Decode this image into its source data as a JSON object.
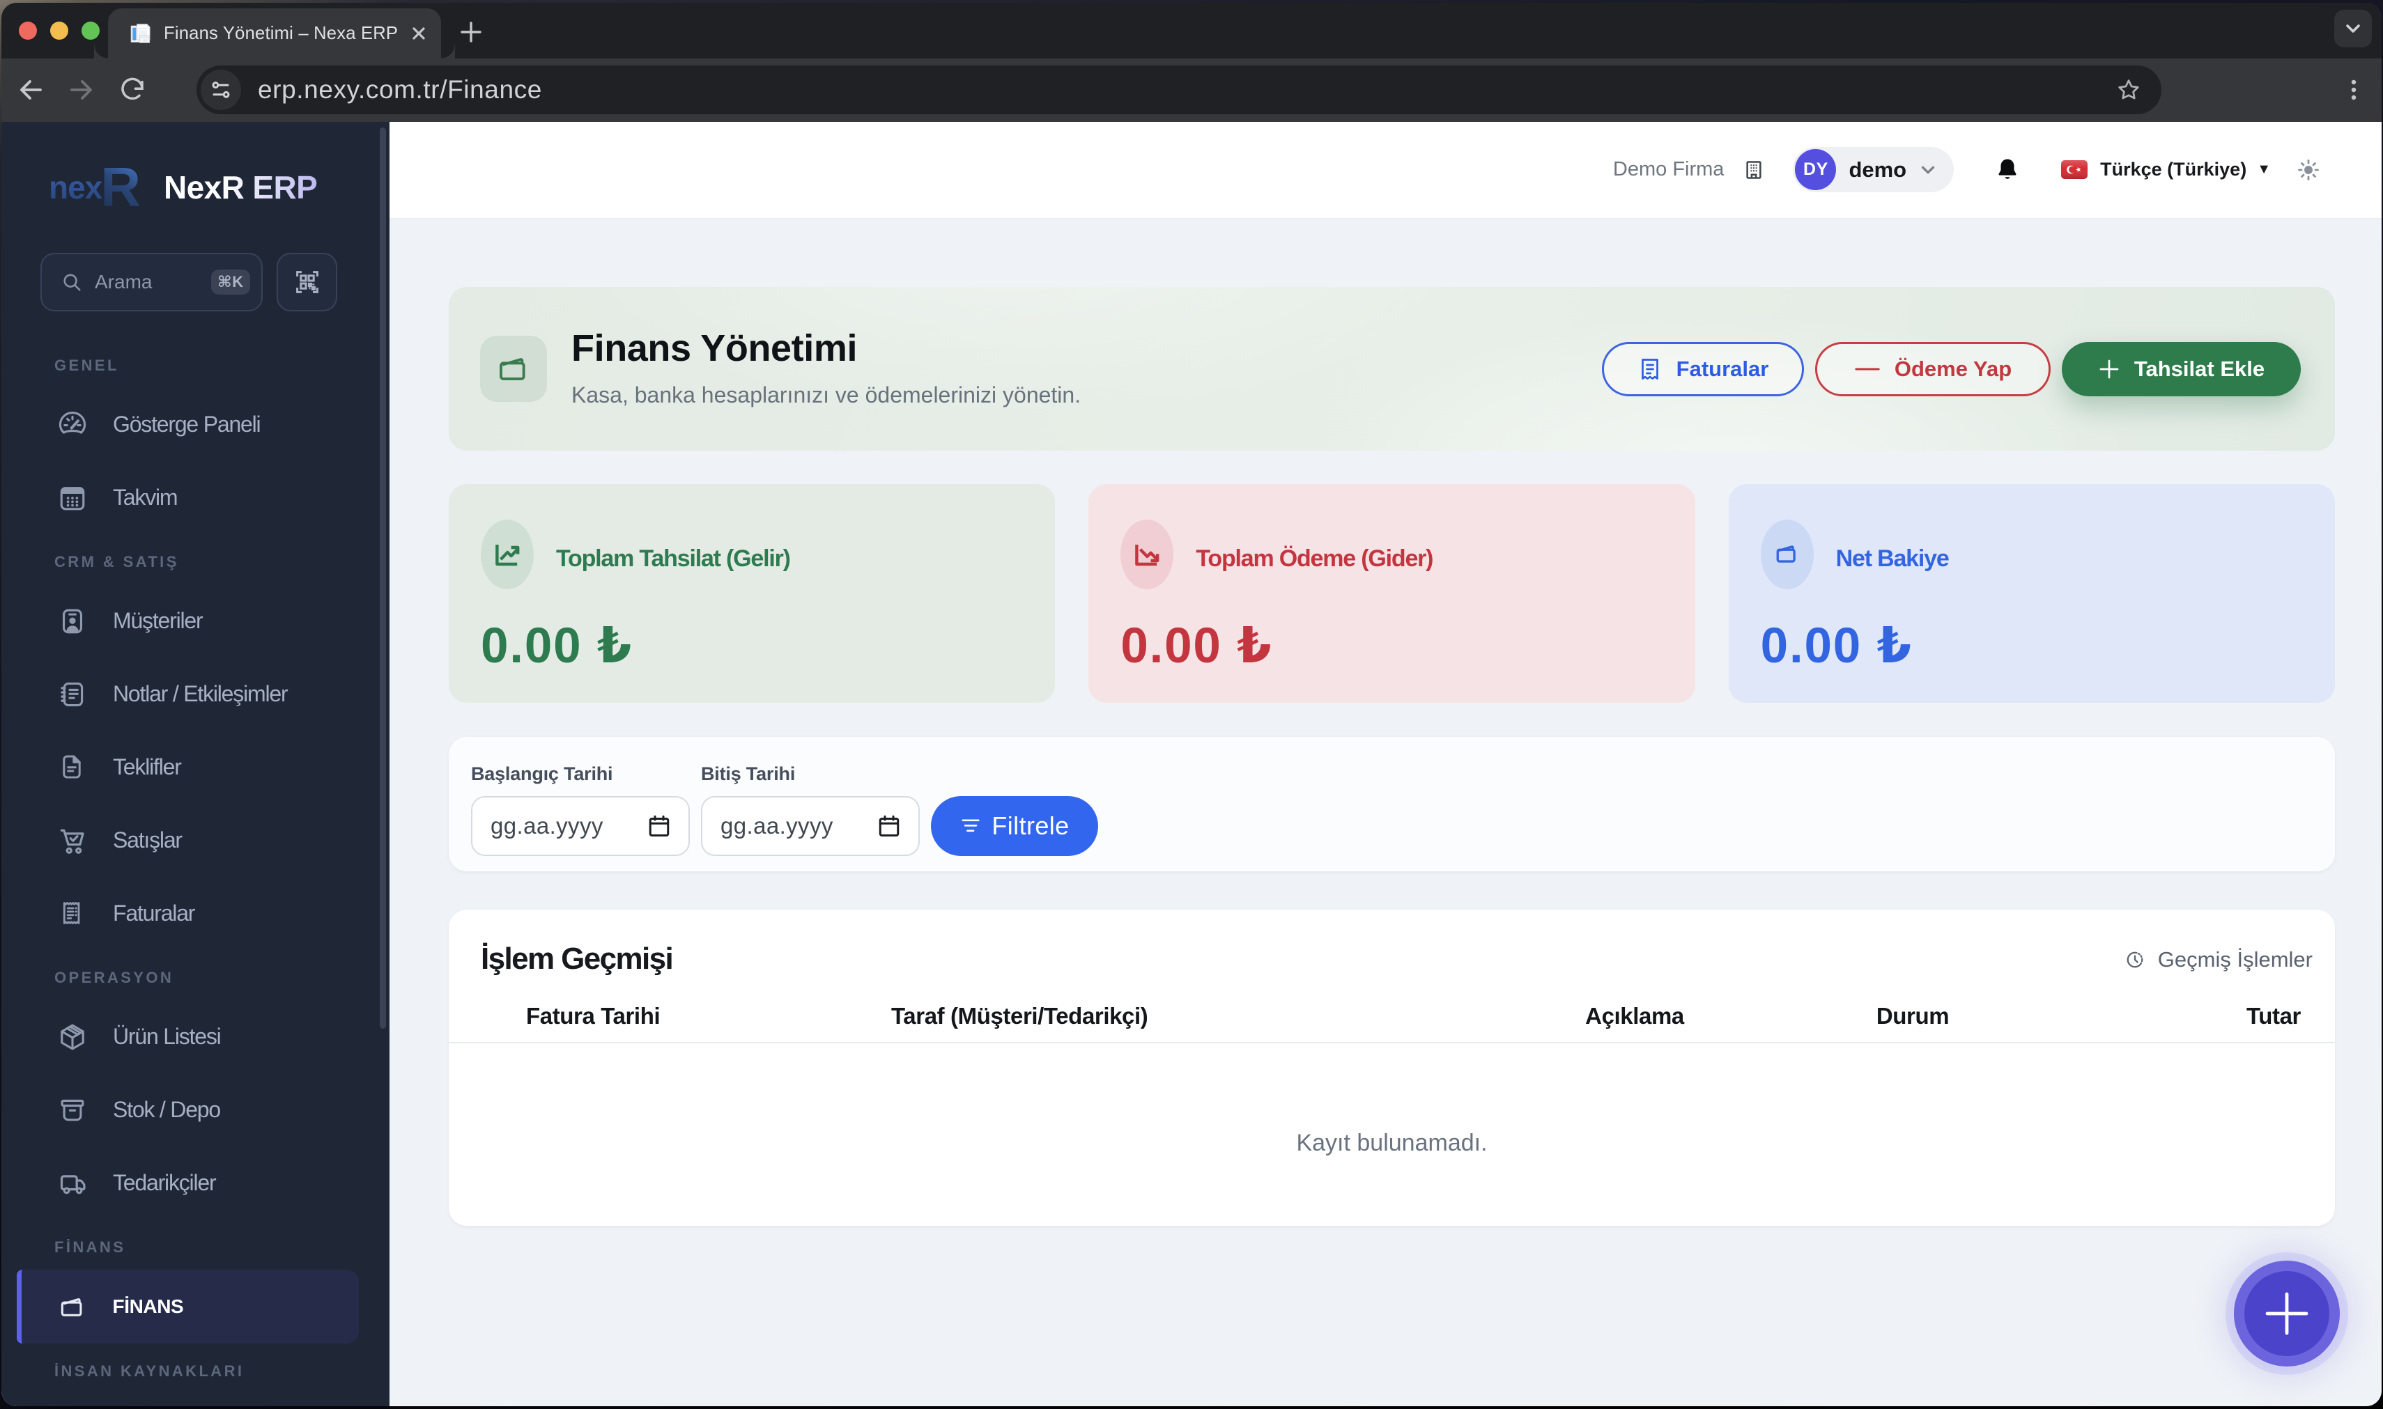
{
  "browser": {
    "tab_title": "Finans Yönetimi – Nexa ERP",
    "url": "erp.nexy.com.tr/Finance"
  },
  "sidebar": {
    "brand_mark": "nex",
    "brand_mark_r": "R",
    "brand_name": "NexR ERP",
    "search": {
      "placeholder": "Arama",
      "shortcut": "⌘K"
    },
    "sections": [
      {
        "label": "GENEL",
        "items": [
          {
            "label": "Gösterge Paneli"
          },
          {
            "label": "Takvim"
          }
        ]
      },
      {
        "label": "CRM & SATIŞ",
        "items": [
          {
            "label": "Müşteriler"
          },
          {
            "label": "Notlar / Etkileşimler"
          },
          {
            "label": "Teklifler"
          },
          {
            "label": "Satışlar"
          },
          {
            "label": "Faturalar"
          }
        ]
      },
      {
        "label": "OPERASYON",
        "items": [
          {
            "label": "Ürün Listesi"
          },
          {
            "label": "Stok / Depo"
          },
          {
            "label": "Tedarikçiler"
          }
        ]
      },
      {
        "label": "FİNANS",
        "items": [
          {
            "label": "FİNANS"
          }
        ]
      },
      {
        "label": "İNSAN KAYNAKLARI",
        "items": []
      }
    ]
  },
  "header": {
    "company": "Demo Firma",
    "user_initials": "DY",
    "user_name": "demo",
    "language": "Türkçe (Türkiye)"
  },
  "hero": {
    "title": "Finans Yönetimi",
    "subtitle": "Kasa, banka hesaplarınızı ve ödemelerinizi yönetin.",
    "buttons": {
      "invoices": "Faturalar",
      "pay": "Ödeme Yap",
      "collect": "Tahsilat Ekle"
    }
  },
  "stats": [
    {
      "label": "Toplam Tahsilat (Gelir)",
      "value": "0.00 ₺",
      "color": "#2e7b4f"
    },
    {
      "label": "Toplam Ödeme (Gider)",
      "value": "0.00 ₺",
      "color": "#c3353f"
    },
    {
      "label": "Net Bakiye",
      "value": "0.00 ₺",
      "color": "#3465e1"
    }
  ],
  "filter": {
    "start_label": "Başlangıç Tarihi",
    "end_label": "Bitiş Tarihi",
    "date_placeholder": "gg.aa.yyyy",
    "button": "Filtrele"
  },
  "table": {
    "title": "İşlem Geçmişi",
    "history_link": "Geçmiş İşlemler",
    "columns": [
      "Fatura Tarihi",
      "Taraf (Müşteri/Tedarikçi)",
      "Açıklama",
      "Durum",
      "Tutar"
    ],
    "empty": "Kayıt bulunamadı.",
    "rows": []
  }
}
